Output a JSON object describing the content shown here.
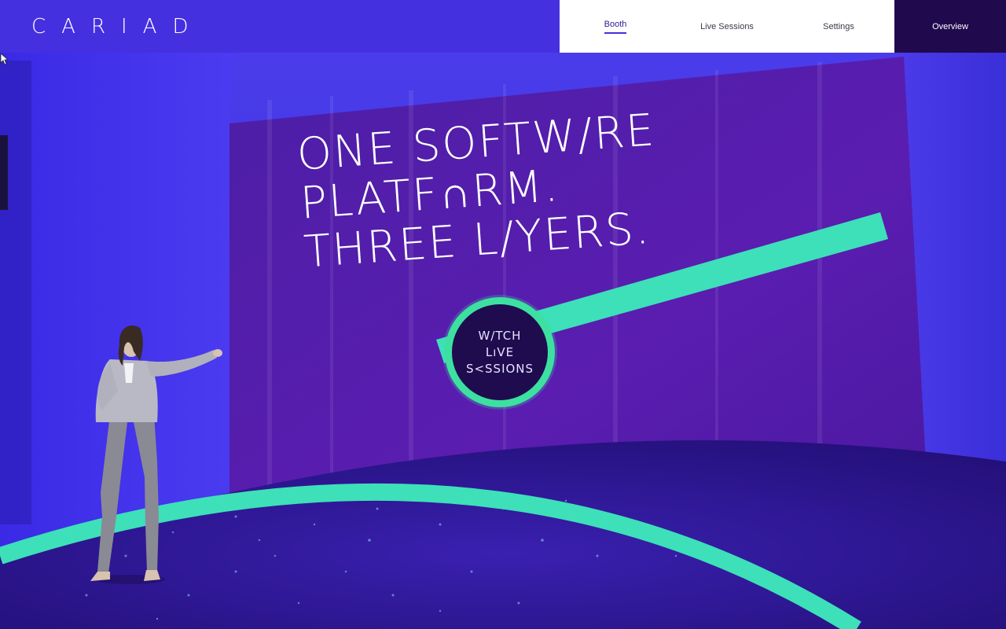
{
  "brand": {
    "logo_text": "CARIAD"
  },
  "nav": {
    "items": [
      {
        "label": "Booth",
        "active": true
      },
      {
        "label": "Live Sessions",
        "active": false
      },
      {
        "label": "Settings",
        "active": false
      }
    ],
    "overview_label": "Overview"
  },
  "stage": {
    "headline": [
      "ONE SOFTW/RE",
      "PLATF∩RM.",
      "THREE L/YERS."
    ],
    "cta_lines": [
      "W/TCH",
      "LıVE",
      "S<SSIONS"
    ]
  },
  "colors": {
    "brand_blue": "#4530e0",
    "nav_white": "#ffffff",
    "overview_dark": "#21094e",
    "accent_mint": "#3de0b8",
    "stage_purple": "#4a1aa0"
  },
  "icons": {
    "cursor": "arrow-cursor-icon"
  }
}
